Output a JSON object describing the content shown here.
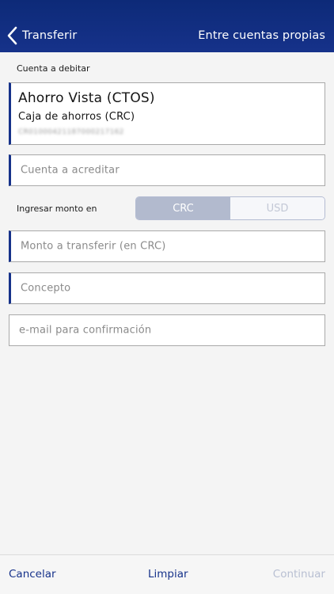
{
  "header": {
    "back_label": "Transferir",
    "title": "Entre cuentas propias"
  },
  "debit": {
    "section_label": "Cuenta a debitar",
    "account_name": "Ahorro Vista (CTOS)",
    "account_type": "Caja de ahorros (CRC)",
    "account_number": "CR01000421187000217162"
  },
  "credit_account": {
    "placeholder": "Cuenta a acreditar"
  },
  "amount_currency": {
    "label": "Ingresar monto en",
    "options": [
      "CRC",
      "USD"
    ],
    "selected": "CRC"
  },
  "amount": {
    "placeholder": "Monto a transferir (en CRC)"
  },
  "concept": {
    "placeholder": "Concepto"
  },
  "email": {
    "placeholder": "e-mail para confirmación"
  },
  "footer": {
    "cancel_label": "Cancelar",
    "clear_label": "Limpiar",
    "continue_label": "Continuar"
  },
  "colors": {
    "header_bg": "#16328a",
    "accent": "#16328a",
    "segment_active": "#b2bace",
    "continue_disabled": "#b8bfd2"
  },
  "icons": {
    "back": "chevron-left-icon"
  }
}
